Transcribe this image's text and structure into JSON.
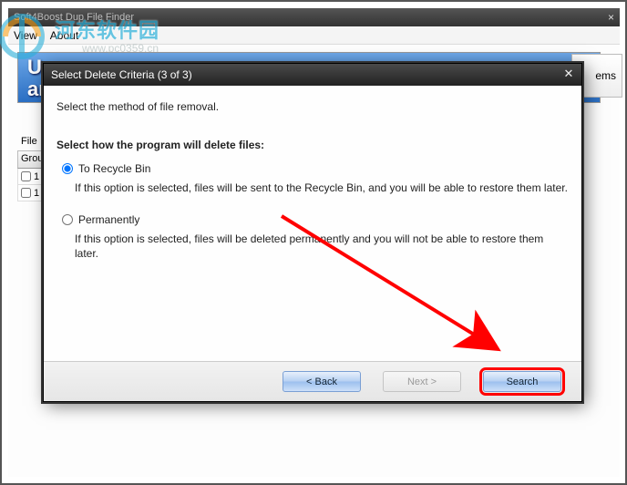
{
  "main_window": {
    "title": "Soft4Boost Dup File Finder",
    "menu": {
      "view": "View",
      "about": "About"
    },
    "banner_line1": "Us",
    "banner_line2": "ar",
    "items_button": "ems",
    "file_label": "File",
    "group_header": "Group",
    "rows": [
      {
        "label": "1"
      },
      {
        "label": "1"
      }
    ]
  },
  "watermark": {
    "name": "河东软件园",
    "url": "www.pc0359.cn"
  },
  "dialog": {
    "title": "Select Delete Criteria (3 of 3)",
    "heading": "Select the method of file removal.",
    "subheading": "Select how the program will delete files:",
    "options": {
      "recycle": {
        "label": "To Recycle Bin",
        "desc": "If this option is selected, files will be sent to the Recycle Bin, and you will be able to restore them later.",
        "selected": true
      },
      "permanent": {
        "label": "Permanently",
        "desc": "If this option is selected, files will be deleted permanently and you will not be able to restore them later.",
        "selected": false
      }
    },
    "buttons": {
      "back": "< Back",
      "next": "Next >",
      "search": "Search"
    }
  }
}
